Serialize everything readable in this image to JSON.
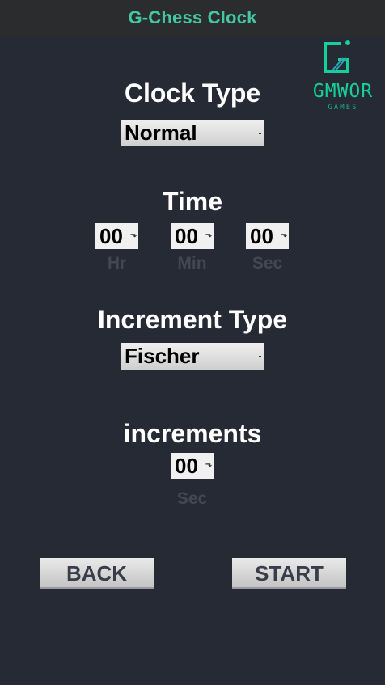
{
  "app": {
    "title": "G-Chess Clock"
  },
  "logo": {
    "wordmark": "GMWOR",
    "subtext": "GAMES",
    "color": "#17cf98"
  },
  "clock_type": {
    "heading": "Clock Type",
    "selected": "Normal"
  },
  "time": {
    "heading": "Time",
    "hours": "00",
    "minutes": "00",
    "seconds": "00",
    "hours_label": "Hr",
    "minutes_label": "Min",
    "seconds_label": "Sec"
  },
  "increment_type": {
    "heading": "Increment Type",
    "selected": "Fischer"
  },
  "increments": {
    "heading": "increments",
    "seconds": "00",
    "seconds_label": "Sec"
  },
  "buttons": {
    "back": "BACK",
    "start": "START"
  },
  "colors": {
    "background": "#262a35",
    "titlebar": "#2a2c2e",
    "accent": "#44c7a1",
    "muted_label": "#434753"
  }
}
